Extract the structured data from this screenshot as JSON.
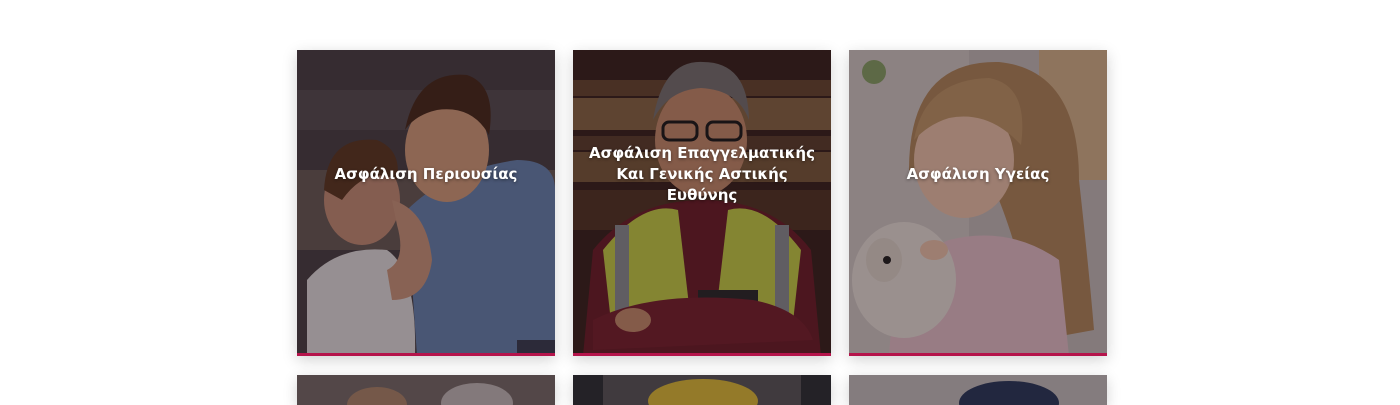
{
  "theme": {
    "accent": "#b5144b"
  },
  "cards": [
    {
      "title": "Ασφάλιση Περιουσίας",
      "icon": "photo-father-son"
    },
    {
      "title": "Ασφάλιση Επαγγελματικής Και Γενικής Αστικής Ευθύνης",
      "icon": "photo-worker-vest"
    },
    {
      "title": "Ασφάλιση Υγείας",
      "icon": "photo-girl-puppy"
    }
  ]
}
